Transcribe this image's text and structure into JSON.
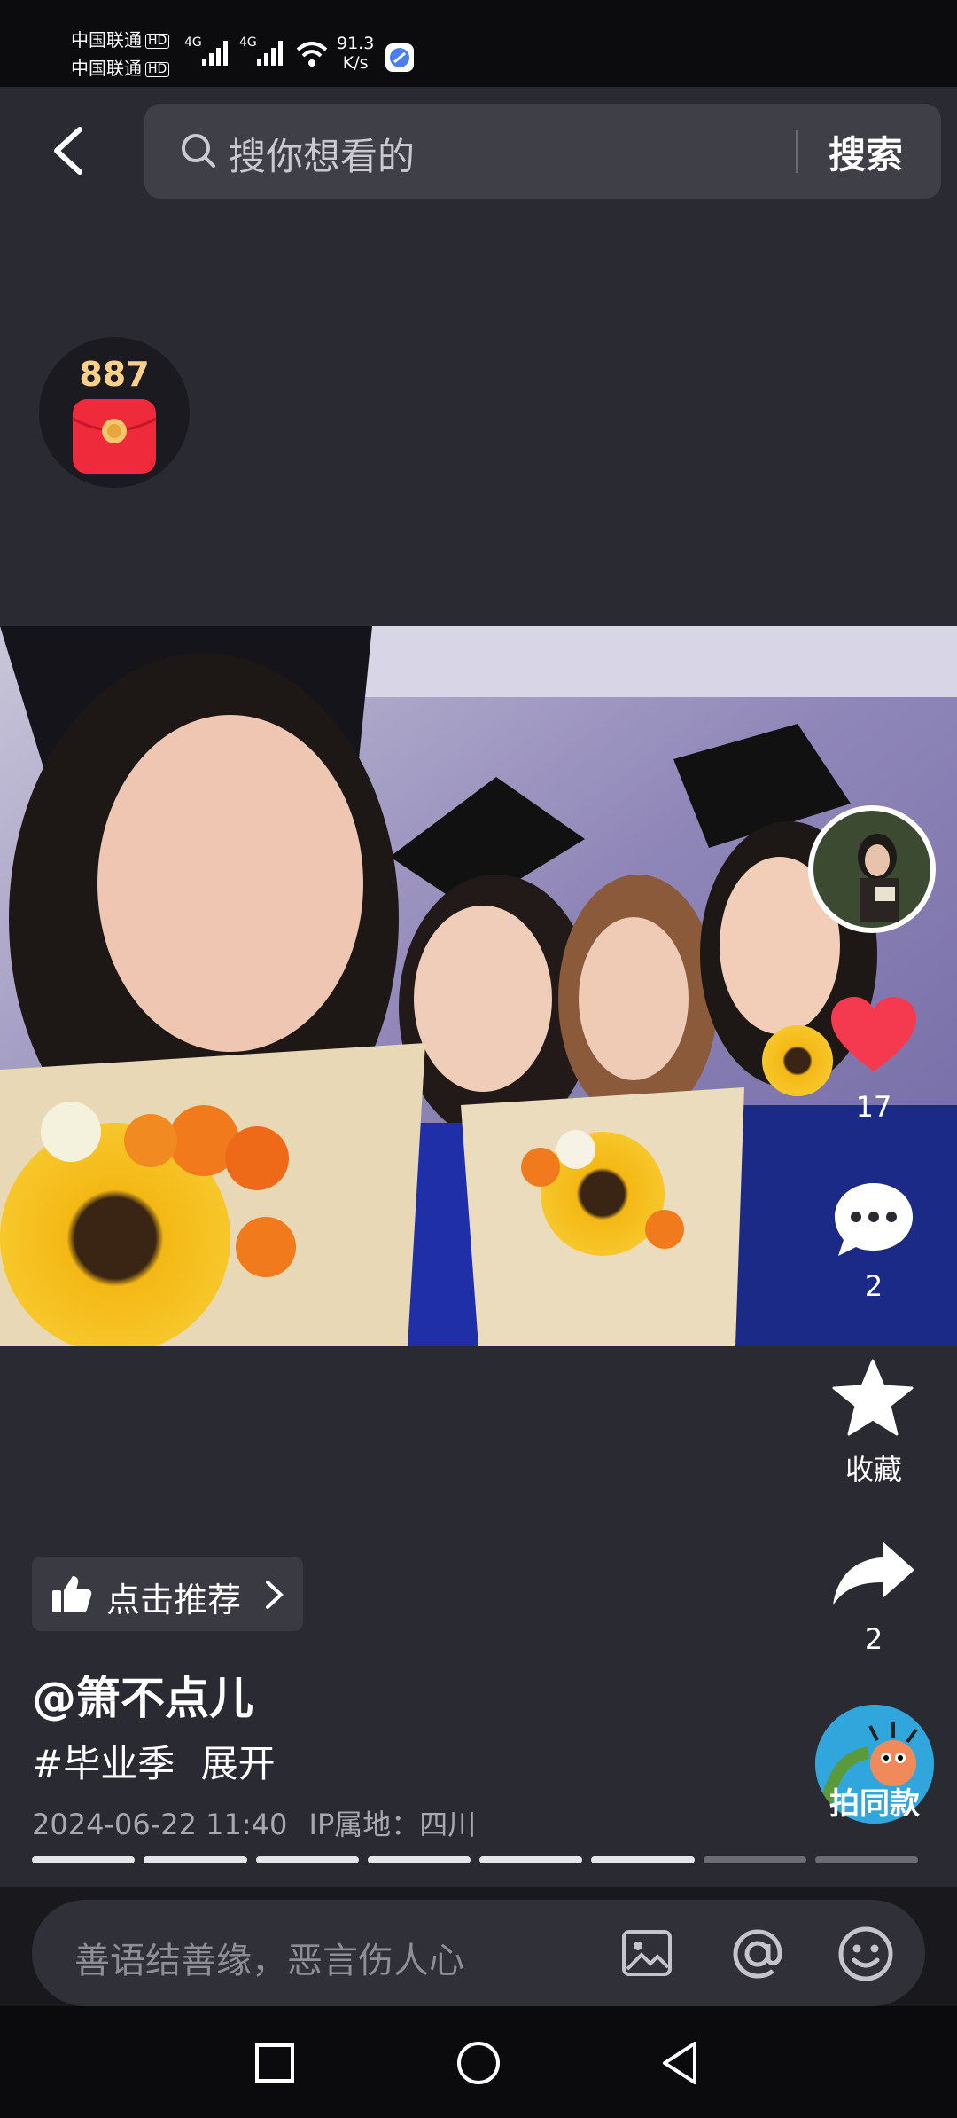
{
  "status_bar": {
    "carrier_1": "中国联通",
    "carrier_2": "中国联通",
    "hd_label": "HD",
    "network_1": "4G",
    "network_2": "4G",
    "speed_value": "91.3",
    "speed_unit": "K/s"
  },
  "header": {
    "search_placeholder": "搜你想看的",
    "search_button": "搜索"
  },
  "red_packet": {
    "count": "887"
  },
  "right_rail": {
    "like_count": "17",
    "comment_count": "2",
    "favorite_label": "收藏",
    "share_count": "2",
    "same_style_label": "拍同款"
  },
  "post": {
    "recommend_label": "点击推荐",
    "author": "@箫不点儿",
    "hashtag": "#毕业季",
    "expand_label": "展开",
    "datetime": "2024-06-22 11:40",
    "ip_location": "IP属地：四川",
    "image_count": 8,
    "current_image": 6
  },
  "comment_bar": {
    "placeholder": "善语结善缘，恶言伤人心"
  },
  "colors": {
    "like_red": "#f5394f",
    "background": "#2a2a33",
    "progress_active": "#e6e6ea",
    "progress_inactive": "#6c6c74"
  }
}
